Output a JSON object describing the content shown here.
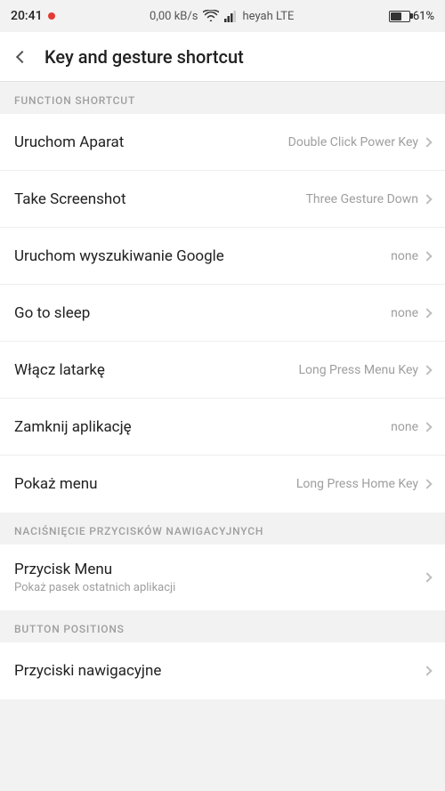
{
  "statusBar": {
    "time": "20:41",
    "network": "0,00 kB/s",
    "carrier": "heyah LTE",
    "battery": "61%"
  },
  "header": {
    "back_label": "back",
    "title": "Key and gesture shortcut"
  },
  "sections": [
    {
      "id": "function-shortcut",
      "header": "FUNCTION SHORTCUT",
      "items": [
        {
          "id": "uruchom-aparat",
          "title": "Uruchom Aparat",
          "value": "Double Click Power Key"
        },
        {
          "id": "take-screenshot",
          "title": "Take Screenshot",
          "value": "Three Gesture Down"
        },
        {
          "id": "uruchom-wyszukiwanie",
          "title": "Uruchom wyszukiwanie Google",
          "value": "none"
        },
        {
          "id": "go-to-sleep",
          "title": "Go to sleep",
          "value": "none"
        },
        {
          "id": "wlacz-latarke",
          "title": "Włącz latarkę",
          "value": "Long Press Menu Key"
        },
        {
          "id": "zamknij-aplikacje",
          "title": "Zamknij aplikację",
          "value": "none"
        },
        {
          "id": "pokaz-menu",
          "title": "Pokaż menu",
          "value": "Long Press Home Key"
        }
      ]
    },
    {
      "id": "nav-buttons",
      "header": "NACIŚNIĘCIE PRZYCISKÓW NAWIGACYJNYCH",
      "items": [
        {
          "id": "przycisk-menu",
          "title": "Przycisk Menu",
          "value": "",
          "subtitle": "Pokaż pasek ostatnich aplikacji"
        }
      ]
    },
    {
      "id": "button-positions",
      "header": "BUTTON POSITIONS",
      "items": [
        {
          "id": "przyciski-nawigacyjne",
          "title": "Przyciski nawigacyjne",
          "value": ""
        }
      ]
    }
  ]
}
